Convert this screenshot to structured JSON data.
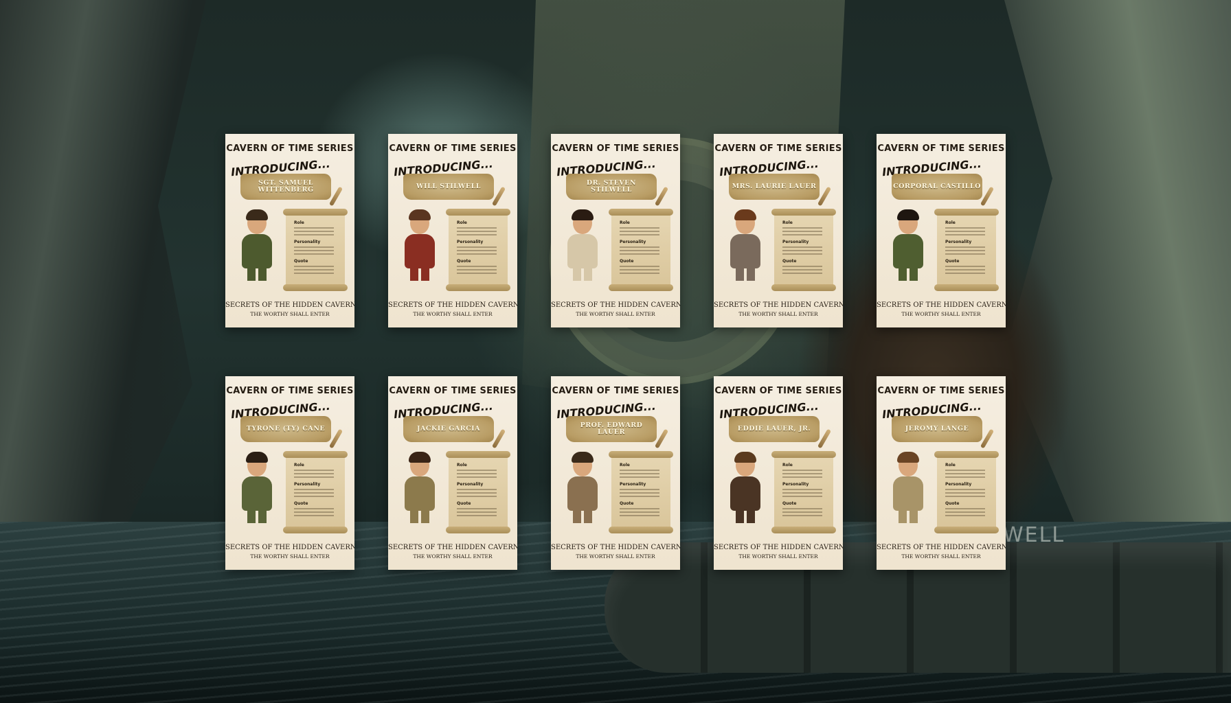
{
  "background": {
    "raft_label": "WELL"
  },
  "cards": [
    {
      "series": "CAVERN OF TIME SERIES",
      "intro": "INTRODUCING...",
      "name": "SGT. SAMUEL WITTENBERG",
      "role_label": "Role",
      "personality_label": "Personality",
      "quote_label": "Quote",
      "footer_title": "SECRETS OF THE HIDDEN CAVERN",
      "footer_tagline": "THE WORTHY SHALL ENTER",
      "outfit": "#4d5a2e",
      "hair": "#3a2a1a"
    },
    {
      "series": "CAVERN OF TIME SERIES",
      "intro": "INTRODUCING...",
      "name": "WILL STILWELL",
      "role_label": "Role",
      "personality_label": "Personality",
      "quote_label": "Quote",
      "footer_title": "SECRETS OF THE HIDDEN CAVERN",
      "footer_tagline": "THE WORTHY SHALL ENTER",
      "outfit": "#8a2e22",
      "hair": "#5a3520"
    },
    {
      "series": "CAVERN OF TIME SERIES",
      "intro": "INTRODUCING...",
      "name": "DR. STEVEN STILWELL",
      "role_label": "Role",
      "personality_label": "Personality",
      "quote_label": "Quote",
      "footer_title": "SECRETS OF THE HIDDEN CAVERN",
      "footer_tagline": "THE WORTHY SHALL ENTER",
      "outfit": "#d6c7a8",
      "hair": "#2a1c12"
    },
    {
      "series": "CAVERN OF TIME SERIES",
      "intro": "INTRODUCING...",
      "name": "MRS. LAURIE LAUER",
      "role_label": "Role",
      "personality_label": "Personality",
      "quote_label": "Quote",
      "footer_title": "SECRETS OF THE HIDDEN CAVERN",
      "footer_tagline": "THE WORTHY SHALL ENTER",
      "outfit": "#7a6a5c",
      "hair": "#6a3a1c"
    },
    {
      "series": "CAVERN OF TIME SERIES",
      "intro": "INTRODUCING...",
      "name": "CORPORAL CASTILLO",
      "role_label": "Role",
      "personality_label": "Personality",
      "quote_label": "Quote",
      "footer_title": "SECRETS OF THE HIDDEN CAVERN",
      "footer_tagline": "THE WORTHY SHALL ENTER",
      "outfit": "#4f5e30",
      "hair": "#1e1610"
    },
    {
      "series": "CAVERN OF TIME SERIES",
      "intro": "INTRODUCING...",
      "name": "TYRONE (TY) CANE",
      "role_label": "Role",
      "personality_label": "Personality",
      "quote_label": "Quote",
      "footer_title": "SECRETS OF THE HIDDEN CAVERN",
      "footer_tagline": "THE WORTHY SHALL ENTER",
      "outfit": "#5a6438",
      "hair": "#2a1e14"
    },
    {
      "series": "CAVERN OF TIME SERIES",
      "intro": "INTRODUCING...",
      "name": "JACKIE GARCIA",
      "role_label": "Role",
      "personality_label": "Personality",
      "quote_label": "Quote",
      "footer_title": "SECRETS OF THE HIDDEN CAVERN",
      "footer_tagline": "THE WORTHY SHALL ENTER",
      "outfit": "#8c7a4c",
      "hair": "#3a2416"
    },
    {
      "series": "CAVERN OF TIME SERIES",
      "intro": "INTRODUCING...",
      "name": "PROF. EDWARD LAUER",
      "role_label": "Role",
      "personality_label": "Personality",
      "quote_label": "Quote",
      "footer_title": "SECRETS OF THE HIDDEN CAVERN",
      "footer_tagline": "THE WORTHY SHALL ENTER",
      "outfit": "#8a7050",
      "hair": "#3a2a1a"
    },
    {
      "series": "CAVERN OF TIME SERIES",
      "intro": "INTRODUCING...",
      "name": "EDDIE LAUER, JR.",
      "role_label": "Role",
      "personality_label": "Personality",
      "quote_label": "Quote",
      "footer_title": "SECRETS OF THE HIDDEN CAVERN",
      "footer_tagline": "THE WORTHY SHALL ENTER",
      "outfit": "#4a3424",
      "hair": "#5a3a1e"
    },
    {
      "series": "CAVERN OF TIME SERIES",
      "intro": "INTRODUCING...",
      "name": "JEROMY LANGE",
      "role_label": "Role",
      "personality_label": "Personality",
      "quote_label": "Quote",
      "footer_title": "SECRETS OF THE HIDDEN CAVERN",
      "footer_tagline": "THE WORTHY SHALL ENTER",
      "outfit": "#a89468",
      "hair": "#6a4424"
    }
  ]
}
